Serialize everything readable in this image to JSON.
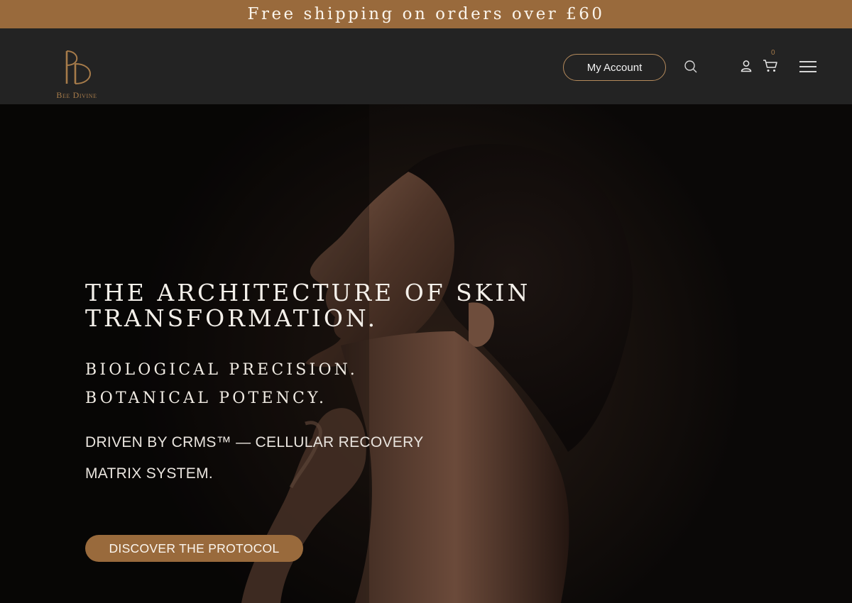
{
  "announcement": {
    "text": "Free shipping on orders over £60"
  },
  "brand": {
    "monogram": "BD",
    "name": "Bee Divine"
  },
  "header": {
    "account_label": "My Account",
    "icons": [
      "search-icon",
      "user-icon",
      "cart-icon",
      "menu-icon"
    ],
    "cart_count": "0"
  },
  "hero": {
    "title": "THE ARCHITECTURE OF SKIN TRANSFORMATION.",
    "subtitle_line1": "BIOLOGICAL PRECISION.",
    "subtitle_line2": "BOTANICAL POTENCY.",
    "body_line1": "DRIVEN BY CRMS™ — CELLULAR RECOVERY",
    "body_line2": "MATRIX SYSTEM.",
    "cta_label": "DISCOVER THE PROTOCOL"
  },
  "colors": {
    "accent": "#996a3c",
    "header_bg": "#232323",
    "hero_bg": "#0a0807",
    "text_light": "#f4f0ea"
  }
}
